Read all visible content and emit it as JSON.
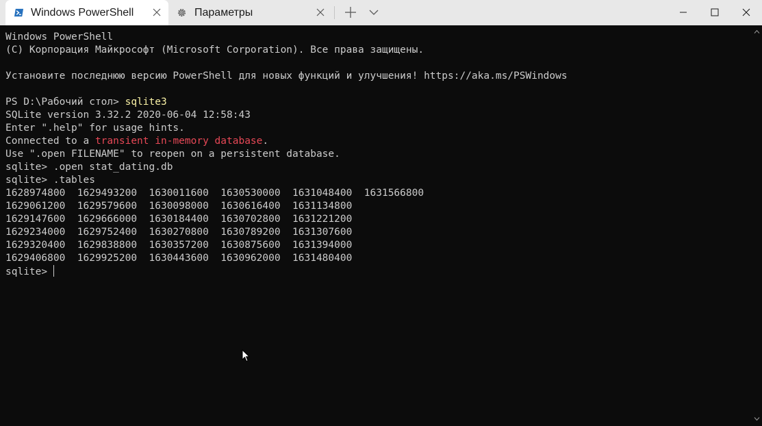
{
  "tabs": [
    {
      "label": "Windows PowerShell",
      "icon": "powershell-icon",
      "active": true
    },
    {
      "label": "Параметры",
      "icon": "gear-icon",
      "active": false
    }
  ],
  "terminal": {
    "banner_1": "Windows PowerShell",
    "banner_2": "(C) Корпорация Майкрософт (Microsoft Corporation). Все права защищены.",
    "update_msg": "Установите последнюю версию PowerShell для новых функций и улучшения! https://aka.ms/PSWindows",
    "ps_prompt": "PS D:\\Рабочий стол> ",
    "ps_command": "sqlite3",
    "sqlite_version": "SQLite version 3.32.2 2020-06-04 12:58:43",
    "help_hint": "Enter \".help\" for usage hints.",
    "connected_prefix": "Connected to a ",
    "connected_highlight": "transient in-memory database",
    "connected_suffix": ".",
    "open_hint": "Use \".open FILENAME\" to reopen on a persistent database.",
    "cmd_open": "sqlite> .open stat_dating.db",
    "cmd_tables": "sqlite> .tables",
    "tables_rows": [
      "1628974800  1629493200  1630011600  1630530000  1631048400  1631566800",
      "1629061200  1629579600  1630098000  1630616400  1631134800",
      "1629147600  1629666000  1630184400  1630702800  1631221200",
      "1629234000  1629752400  1630270800  1630789200  1631307600",
      "1629320400  1629838800  1630357200  1630875600  1631394000",
      "1629406800  1629925200  1630443600  1630962000  1631480400"
    ],
    "final_prompt": "sqlite> "
  },
  "colors": {
    "terminal_bg": "#0c0c0c",
    "terminal_fg": "#cccccc",
    "highlight_yellow": "#f9f1a5",
    "highlight_red": "#e74856",
    "titlebar_bg": "#e8e8e8",
    "powershell_icon": "#2671be"
  }
}
